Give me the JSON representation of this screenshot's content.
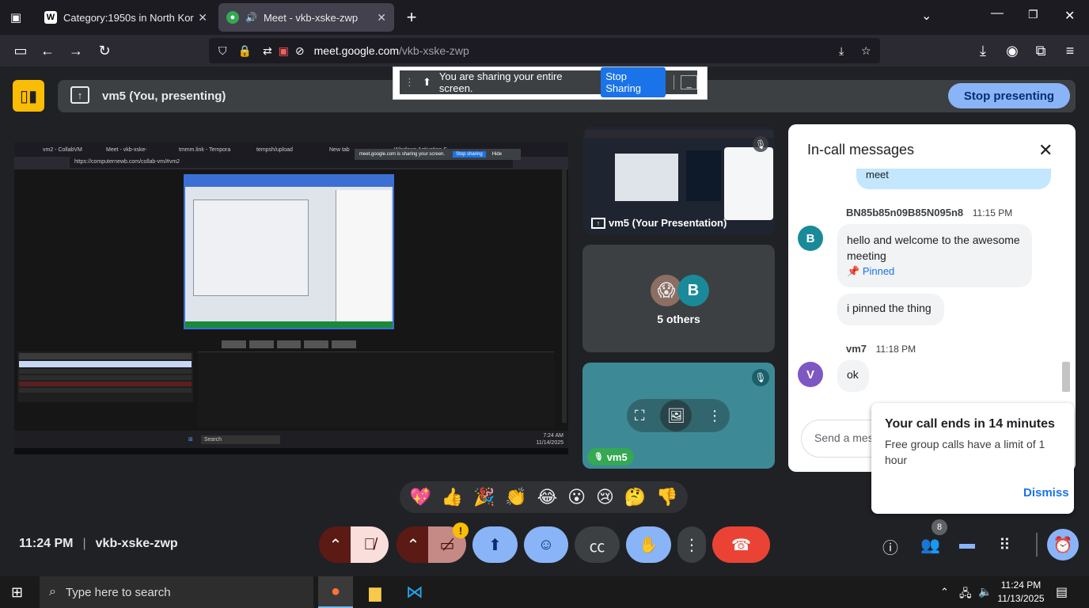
{
  "browser": {
    "tabs": [
      {
        "title": "Category:1950s in North Korea",
        "icon": "wikipedia-icon"
      },
      {
        "title": "Meet - vkb-xske-zwp",
        "icon": "meet-icon"
      }
    ],
    "url_domain": "meet.google.com",
    "url_path": "/vkb-xske-zwp"
  },
  "share_banner": {
    "text": "You are sharing your entire screen.",
    "stop_label": "Stop Sharing",
    "hide_label": "_"
  },
  "present_bar": {
    "label": "vm5 (You, presenting)",
    "stop_label": "Stop presenting"
  },
  "stage": {
    "inner_tabs": [
      "vm2 - CollabVM",
      "Meet - vkb-xske-",
      "tmmm.link - Tempora",
      "tempsh/upload",
      "New tab",
      "Windows Activation S"
    ],
    "inner_url": "https://computernewb.com/collab-vm/#vm2",
    "inner_share_text": "meet.google.com is sharing your screen.",
    "inner_stop": "Stop sharing",
    "inner_hide": "Hide",
    "inner_search": "Search",
    "inner_time": "7:24 AM",
    "inner_date": "11/14/2025"
  },
  "tiles": {
    "presentation_label": "vm5 (Your Presentation)",
    "others_label": "5 others",
    "others_avatar": "B",
    "vm5_label": "vm5"
  },
  "chat": {
    "title": "In-call messages",
    "partial_text": "meet",
    "messages": [
      {
        "sender": "BN85b85n09B85N095n8",
        "time": "11:15 PM",
        "avatar": "B",
        "text": "hello and welcome to the awesome meeting",
        "pinned": "Pinned"
      },
      {
        "text": "i pinned the thing"
      },
      {
        "sender": "vm7",
        "time": "11:18 PM",
        "avatar": "V",
        "text": "ok"
      }
    ],
    "input_placeholder": "Send a message"
  },
  "toast": {
    "title": "Your call ends in 14 minutes",
    "body": "Free group calls have a limit of 1 hour",
    "dismiss": "Dismiss"
  },
  "reactions": [
    "💖",
    "👍",
    "🎉",
    "👏",
    "😂",
    "😮",
    "😢",
    "🤔",
    "👎"
  ],
  "footer": {
    "time": "11:24 PM",
    "meeting_code": "vkb-xske-zwp",
    "people_count": "8"
  },
  "taskbar": {
    "search_placeholder": "Type here to search",
    "time": "11:24 PM",
    "date": "11/13/2025"
  },
  "colors": {
    "meet_bg": "#202124",
    "accent_blue": "#8ab4f8",
    "end_call_red": "#ea4335",
    "muted_red": "#f9dedc",
    "avatar_b": "#1a8a9a",
    "avatar_v": "#7e57c2"
  }
}
